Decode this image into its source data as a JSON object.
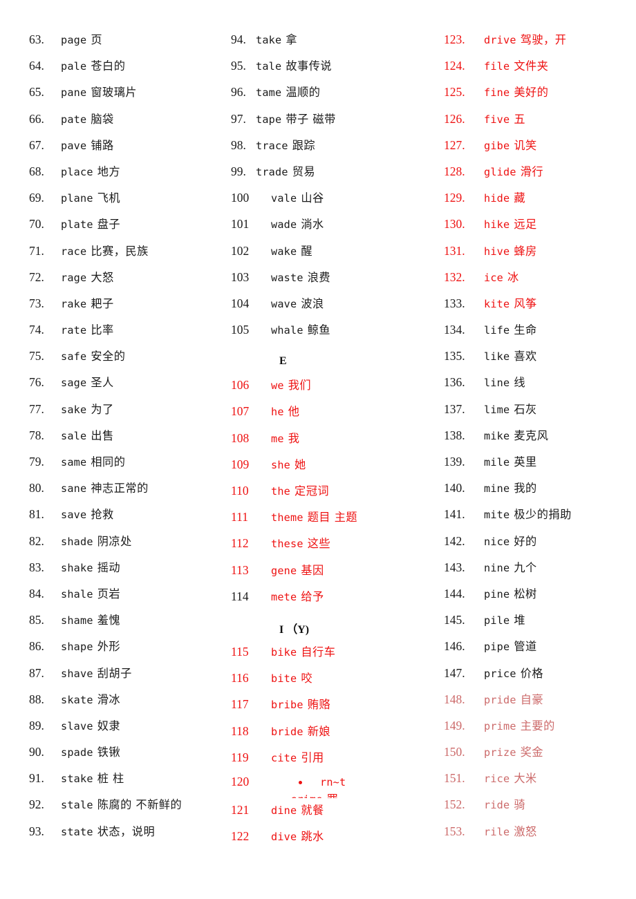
{
  "document": {
    "type": "vocabulary-word-list",
    "colors": {
      "black": "#1b1b1b",
      "red": "#ee1111",
      "faded_red": "#cc6a6a",
      "background": "#ffffff"
    }
  },
  "columns": [
    {
      "id": "column-1",
      "entries": [
        {
          "num": "63.",
          "en": "page",
          "zh": "页",
          "color": "black"
        },
        {
          "num": "64.",
          "en": "pale",
          "zh": "苍白的",
          "color": "black"
        },
        {
          "num": "65.",
          "en": "pane",
          "zh": "窗玻璃片",
          "color": "black"
        },
        {
          "num": "66.",
          "en": "pate",
          "zh": "脑袋",
          "color": "black"
        },
        {
          "num": "67.",
          "en": "pave",
          "zh": "铺路",
          "color": "black"
        },
        {
          "num": "68.",
          "en": "place",
          "zh": "地方",
          "color": "black"
        },
        {
          "num": "69.",
          "en": "plane",
          "zh": "飞机",
          "color": "black"
        },
        {
          "num": "70.",
          "en": "plate",
          "zh": "盘子",
          "color": "black"
        },
        {
          "num": "71.",
          "en": "race",
          "zh": "比赛，民族",
          "color": "black"
        },
        {
          "num": "72.",
          "en": "rage",
          "zh": "大怒",
          "color": "black"
        },
        {
          "num": "73.",
          "en": "rake",
          "zh": "耙子",
          "color": "black"
        },
        {
          "num": "74.",
          "en": "rate",
          "zh": "比率",
          "color": "black"
        },
        {
          "num": "75.",
          "en": "safe",
          "zh": "安全的",
          "color": "black"
        },
        {
          "num": "76.",
          "en": "sage",
          "zh": "圣人",
          "color": "black"
        },
        {
          "num": "77.",
          "en": "sake",
          "zh": "为了",
          "color": "black"
        },
        {
          "num": "78.",
          "en": "sale",
          "zh": "出售",
          "color": "black"
        },
        {
          "num": "79.",
          "en": "same",
          "zh": "相同的",
          "color": "black"
        },
        {
          "num": "80.",
          "en": "sane",
          "zh": "神志正常的",
          "color": "black"
        },
        {
          "num": "81.",
          "en": "save",
          "zh": "抢救",
          "color": "black"
        },
        {
          "num": "82.",
          "en": "shade",
          "zh": "阴凉处",
          "color": "black"
        },
        {
          "num": "83.",
          "en": "shake",
          "zh": "摇动",
          "color": "black"
        },
        {
          "num": "84.",
          "en": "shale",
          "zh": "页岩",
          "color": "black"
        },
        {
          "num": "85.",
          "en": "shame",
          "zh": "羞愧",
          "color": "black"
        },
        {
          "num": "86.",
          "en": "shape",
          "zh": "外形",
          "color": "black"
        },
        {
          "num": "87.",
          "en": "shave",
          "zh": "刮胡子",
          "color": "black"
        },
        {
          "num": "88.",
          "en": "skate",
          "zh": "滑冰",
          "color": "black"
        },
        {
          "num": "89.",
          "en": "slave",
          "zh": "奴隶",
          "color": "black"
        },
        {
          "num": "90.",
          "en": "spade",
          "zh": "铁锹",
          "color": "black"
        },
        {
          "num": "91.",
          "en": "stake",
          "zh": "桩 柱",
          "color": "black"
        },
        {
          "num": "92.",
          "en": "stale",
          "zh": "陈腐的 不新鲜的",
          "color": "black"
        },
        {
          "num": "93.",
          "en": "state",
          "zh": "状态，说明",
          "color": "black"
        }
      ]
    },
    {
      "id": "column-2",
      "entries": [
        {
          "num": "94.",
          "en": "take",
          "zh": "拿",
          "color": "black",
          "indent": 0
        },
        {
          "num": "95.",
          "en": "tale",
          "zh": "故事传说",
          "color": "black",
          "indent": 0
        },
        {
          "num": "96.",
          "en": "tame",
          "zh": "温顺的",
          "color": "black",
          "indent": 0
        },
        {
          "num": "97.",
          "en": "tape",
          "zh": "带子 磁带",
          "color": "black",
          "indent": 0
        },
        {
          "num": "98.",
          "en": "trace",
          "zh": "跟踪",
          "color": "black",
          "indent": 0
        },
        {
          "num": "99.",
          "en": "trade",
          "zh": "贸易",
          "color": "black",
          "indent": 0
        },
        {
          "num": "100",
          "en": "vale",
          "zh": "山谷",
          "color": "black",
          "indent": 1
        },
        {
          "num": "101",
          "en": "wade",
          "zh": "淌水",
          "color": "black",
          "indent": 1
        },
        {
          "num": "102",
          "en": "wake",
          "zh": "醒",
          "color": "black",
          "indent": 1
        },
        {
          "num": "103",
          "en": "waste",
          "zh": "浪费",
          "color": "black",
          "indent": 1
        },
        {
          "num": "104",
          "en": "wave",
          "zh": "波浪",
          "color": "black",
          "indent": 1
        },
        {
          "num": "105",
          "en": "whale",
          "zh": "鲸鱼",
          "color": "black",
          "indent": 1
        },
        {
          "header": "E"
        },
        {
          "num": "106",
          "en": "we",
          "zh": "我们",
          "color": "red",
          "indent": 1
        },
        {
          "num": "107",
          "en": "he",
          "zh": "他",
          "color": "red",
          "indent": 1
        },
        {
          "num": "108",
          "en": "me",
          "zh": "我",
          "color": "red",
          "indent": 1
        },
        {
          "num": "109",
          "en": "she",
          "zh": "她",
          "color": "red",
          "indent": 1
        },
        {
          "num": "110",
          "en": "the",
          "zh": "定冠词",
          "color": "red",
          "indent": 1
        },
        {
          "num": "111",
          "en": "theme",
          "zh": "题目 主题",
          "color": "red",
          "indent": 1
        },
        {
          "num": "112",
          "en": "these",
          "zh": "这些",
          "color": "red",
          "indent": 1
        },
        {
          "num": "113",
          "en": "gene",
          "zh": "基因",
          "color": "red",
          "indent": 1
        },
        {
          "num": "114",
          "en": "mete",
          "zh": "给予",
          "color": "red-text",
          "indent": 1
        },
        {
          "header": "I （Y)"
        },
        {
          "num": "115",
          "en": "bike",
          "zh": "自行车",
          "color": "red",
          "indent": 1
        },
        {
          "num": "116",
          "en": "bite",
          "zh": "咬",
          "color": "red",
          "indent": 1
        },
        {
          "num": "117",
          "en": "bribe",
          "zh": "贿赂",
          "color": "red",
          "indent": 1
        },
        {
          "num": "118",
          "en": "bride",
          "zh": "新娘",
          "color": "red",
          "indent": 1
        },
        {
          "num": "119",
          "en": "cite",
          "zh": "引用",
          "color": "red",
          "indent": 1
        },
        {
          "num": "120",
          "en": "crime",
          "zh": "罪",
          "color": "red",
          "indent": 1,
          "glitch": true,
          "glitch_fragment": "rn~t"
        },
        {
          "num": "121",
          "en": "dine",
          "zh": "就餐",
          "color": "red",
          "indent": 1
        },
        {
          "num": "122",
          "en": "dive",
          "zh": "跳水",
          "color": "red",
          "indent": 1
        }
      ]
    },
    {
      "id": "column-3",
      "entries": [
        {
          "num": "123.",
          "en": "drive",
          "zh": "驾驶，开",
          "color": "red"
        },
        {
          "num": "124.",
          "en": "file",
          "zh": "文件夹",
          "color": "red"
        },
        {
          "num": "125.",
          "en": "fine",
          "zh": "美好的",
          "color": "red"
        },
        {
          "num": "126.",
          "en": "five",
          "zh": "五",
          "color": "red"
        },
        {
          "num": "127.",
          "en": "gibe",
          "zh": "讥笑",
          "color": "red"
        },
        {
          "num": "128.",
          "en": "glide",
          "zh": "滑行",
          "color": "red"
        },
        {
          "num": "129.",
          "en": "hide",
          "zh": "藏",
          "color": "red"
        },
        {
          "num": "130.",
          "en": "hike",
          "zh": "远足",
          "color": "red"
        },
        {
          "num": "131.",
          "en": "hive",
          "zh": "蜂房",
          "color": "red"
        },
        {
          "num": "132.",
          "en": "ice",
          "zh": "冰",
          "color": "red"
        },
        {
          "num": "133.",
          "en": "kite",
          "zh": "风筝",
          "color": "red-text"
        },
        {
          "num": "134.",
          "en": "life",
          "zh": "生命",
          "color": "black"
        },
        {
          "num": "135.",
          "en": "like",
          "zh": "喜欢",
          "color": "black"
        },
        {
          "num": "136.",
          "en": "line",
          "zh": "线",
          "color": "black"
        },
        {
          "num": "137.",
          "en": "lime",
          "zh": "石灰",
          "color": "black"
        },
        {
          "num": "138.",
          "en": "mike",
          "zh": "麦克风",
          "color": "black"
        },
        {
          "num": "139.",
          "en": "mile",
          "zh": "英里",
          "color": "black"
        },
        {
          "num": "140.",
          "en": "mine",
          "zh": "我的",
          "color": "black"
        },
        {
          "num": "141.",
          "en": "mite",
          "zh": "极少的捐助",
          "color": "black"
        },
        {
          "num": "142.",
          "en": "nice",
          "zh": "好的",
          "color": "black"
        },
        {
          "num": "143.",
          "en": "nine",
          "zh": "九个",
          "color": "black"
        },
        {
          "num": "144.",
          "en": "pine",
          "zh": "松树",
          "color": "black"
        },
        {
          "num": "145.",
          "en": "pile",
          "zh": "堆",
          "color": "black"
        },
        {
          "num": "146.",
          "en": "pipe",
          "zh": "管道",
          "color": "black"
        },
        {
          "num": "147.",
          "en": "price",
          "zh": "价格",
          "color": "black"
        },
        {
          "num": "148.",
          "en": "pride",
          "zh": "自豪",
          "color": "fade"
        },
        {
          "num": "149.",
          "en": "prime",
          "zh": "主要的",
          "color": "fade"
        },
        {
          "num": "150.",
          "en": "prize",
          "zh": "奖金",
          "color": "fade"
        },
        {
          "num": "151.",
          "en": "rice",
          "zh": "大米",
          "color": "fade"
        },
        {
          "num": "152.",
          "en": "ride",
          "zh": "骑",
          "color": "fade"
        },
        {
          "num": "153.",
          "en": "rile",
          "zh": "激怒",
          "color": "fade"
        }
      ]
    }
  ]
}
